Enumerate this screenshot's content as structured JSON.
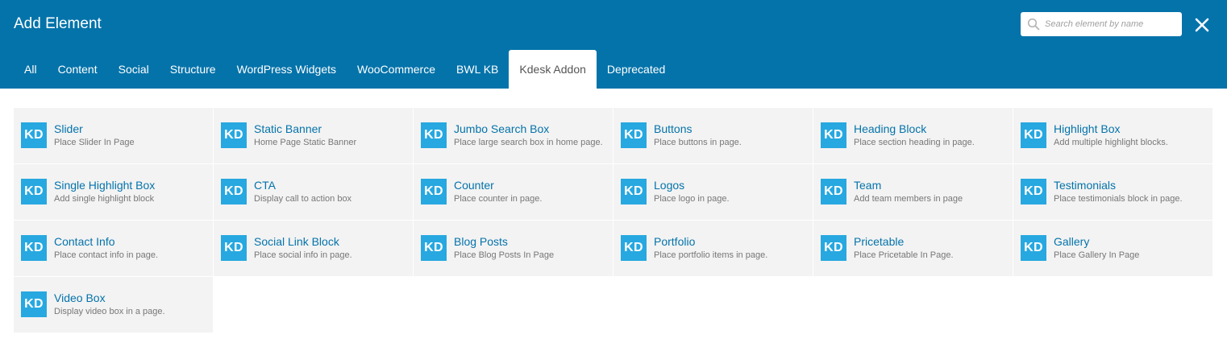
{
  "header": {
    "title": "Add Element",
    "background": "#0473aa",
    "search_placeholder": "Search element by name",
    "close_icon": "close-icon"
  },
  "tabs": [
    {
      "label": "All"
    },
    {
      "label": "Content"
    },
    {
      "label": "Social"
    },
    {
      "label": "Structure"
    },
    {
      "label": "WordPress Widgets"
    },
    {
      "label": "WooCommerce"
    },
    {
      "label": "BWL KB"
    },
    {
      "label": "Kdesk Addon",
      "active": true
    },
    {
      "label": "Deprecated"
    }
  ],
  "icon_label": "KD",
  "icon_color": "#27a8e0",
  "elements": [
    {
      "name": "Slider",
      "desc": "Place Slider In Page"
    },
    {
      "name": "Static Banner",
      "desc": "Home Page Static Banner"
    },
    {
      "name": "Jumbo Search Box",
      "desc": "Place large search box in home page."
    },
    {
      "name": "Buttons",
      "desc": "Place buttons in page."
    },
    {
      "name": "Heading Block",
      "desc": "Place section heading in page."
    },
    {
      "name": "Highlight Box",
      "desc": "Add multiple highlight blocks."
    },
    {
      "name": "Single Highlight Box",
      "desc": "Add single highlight block"
    },
    {
      "name": "CTA",
      "desc": "Display call to action box"
    },
    {
      "name": "Counter",
      "desc": "Place counter in page."
    },
    {
      "name": "Logos",
      "desc": "Place logo in page."
    },
    {
      "name": "Team",
      "desc": "Add team members in page"
    },
    {
      "name": "Testimonials",
      "desc": "Place testimonials block in page."
    },
    {
      "name": "Contact Info",
      "desc": "Place contact info in page."
    },
    {
      "name": "Social Link Block",
      "desc": "Place social info in page."
    },
    {
      "name": "Blog Posts",
      "desc": "Place Blog Posts In Page"
    },
    {
      "name": "Portfolio",
      "desc": "Place portfolio items in page."
    },
    {
      "name": "Pricetable",
      "desc": "Place Pricetable In Page."
    },
    {
      "name": "Gallery",
      "desc": "Place Gallery In Page"
    },
    {
      "name": "Video Box",
      "desc": "Display video box in a page."
    }
  ]
}
